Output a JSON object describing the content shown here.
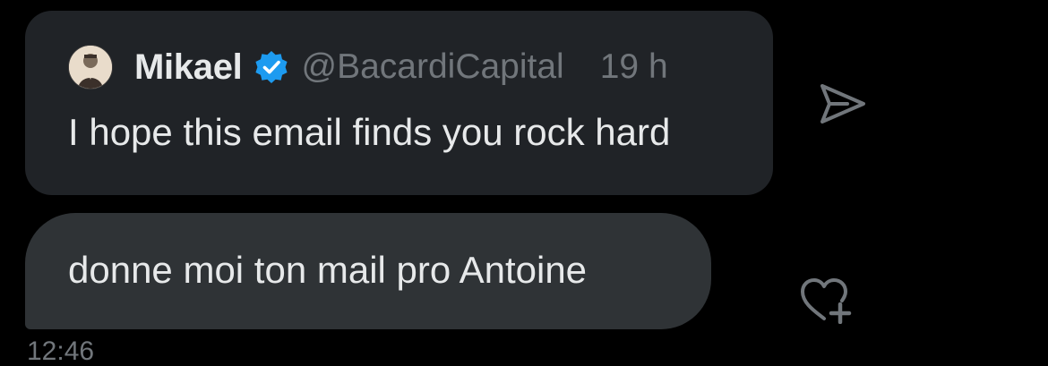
{
  "quoted_post": {
    "author_name": "Mikael",
    "author_handle": "@BacardiCapital",
    "time": "19 h",
    "text": "I hope this email finds you rock hard",
    "verified": true
  },
  "message": {
    "text": "donne moi ton mail pro Antoine"
  },
  "timestamp": "12:46",
  "icons": {
    "share": "send-arrow-icon",
    "react": "heart-plus-icon",
    "verified": "verified-badge-icon"
  },
  "colors": {
    "background": "#000000",
    "card": "#202327",
    "bubble": "#2f3336",
    "primary_text": "#e7e9ea",
    "secondary_text": "#71767b",
    "verified_blue": "#1d9bf0"
  }
}
